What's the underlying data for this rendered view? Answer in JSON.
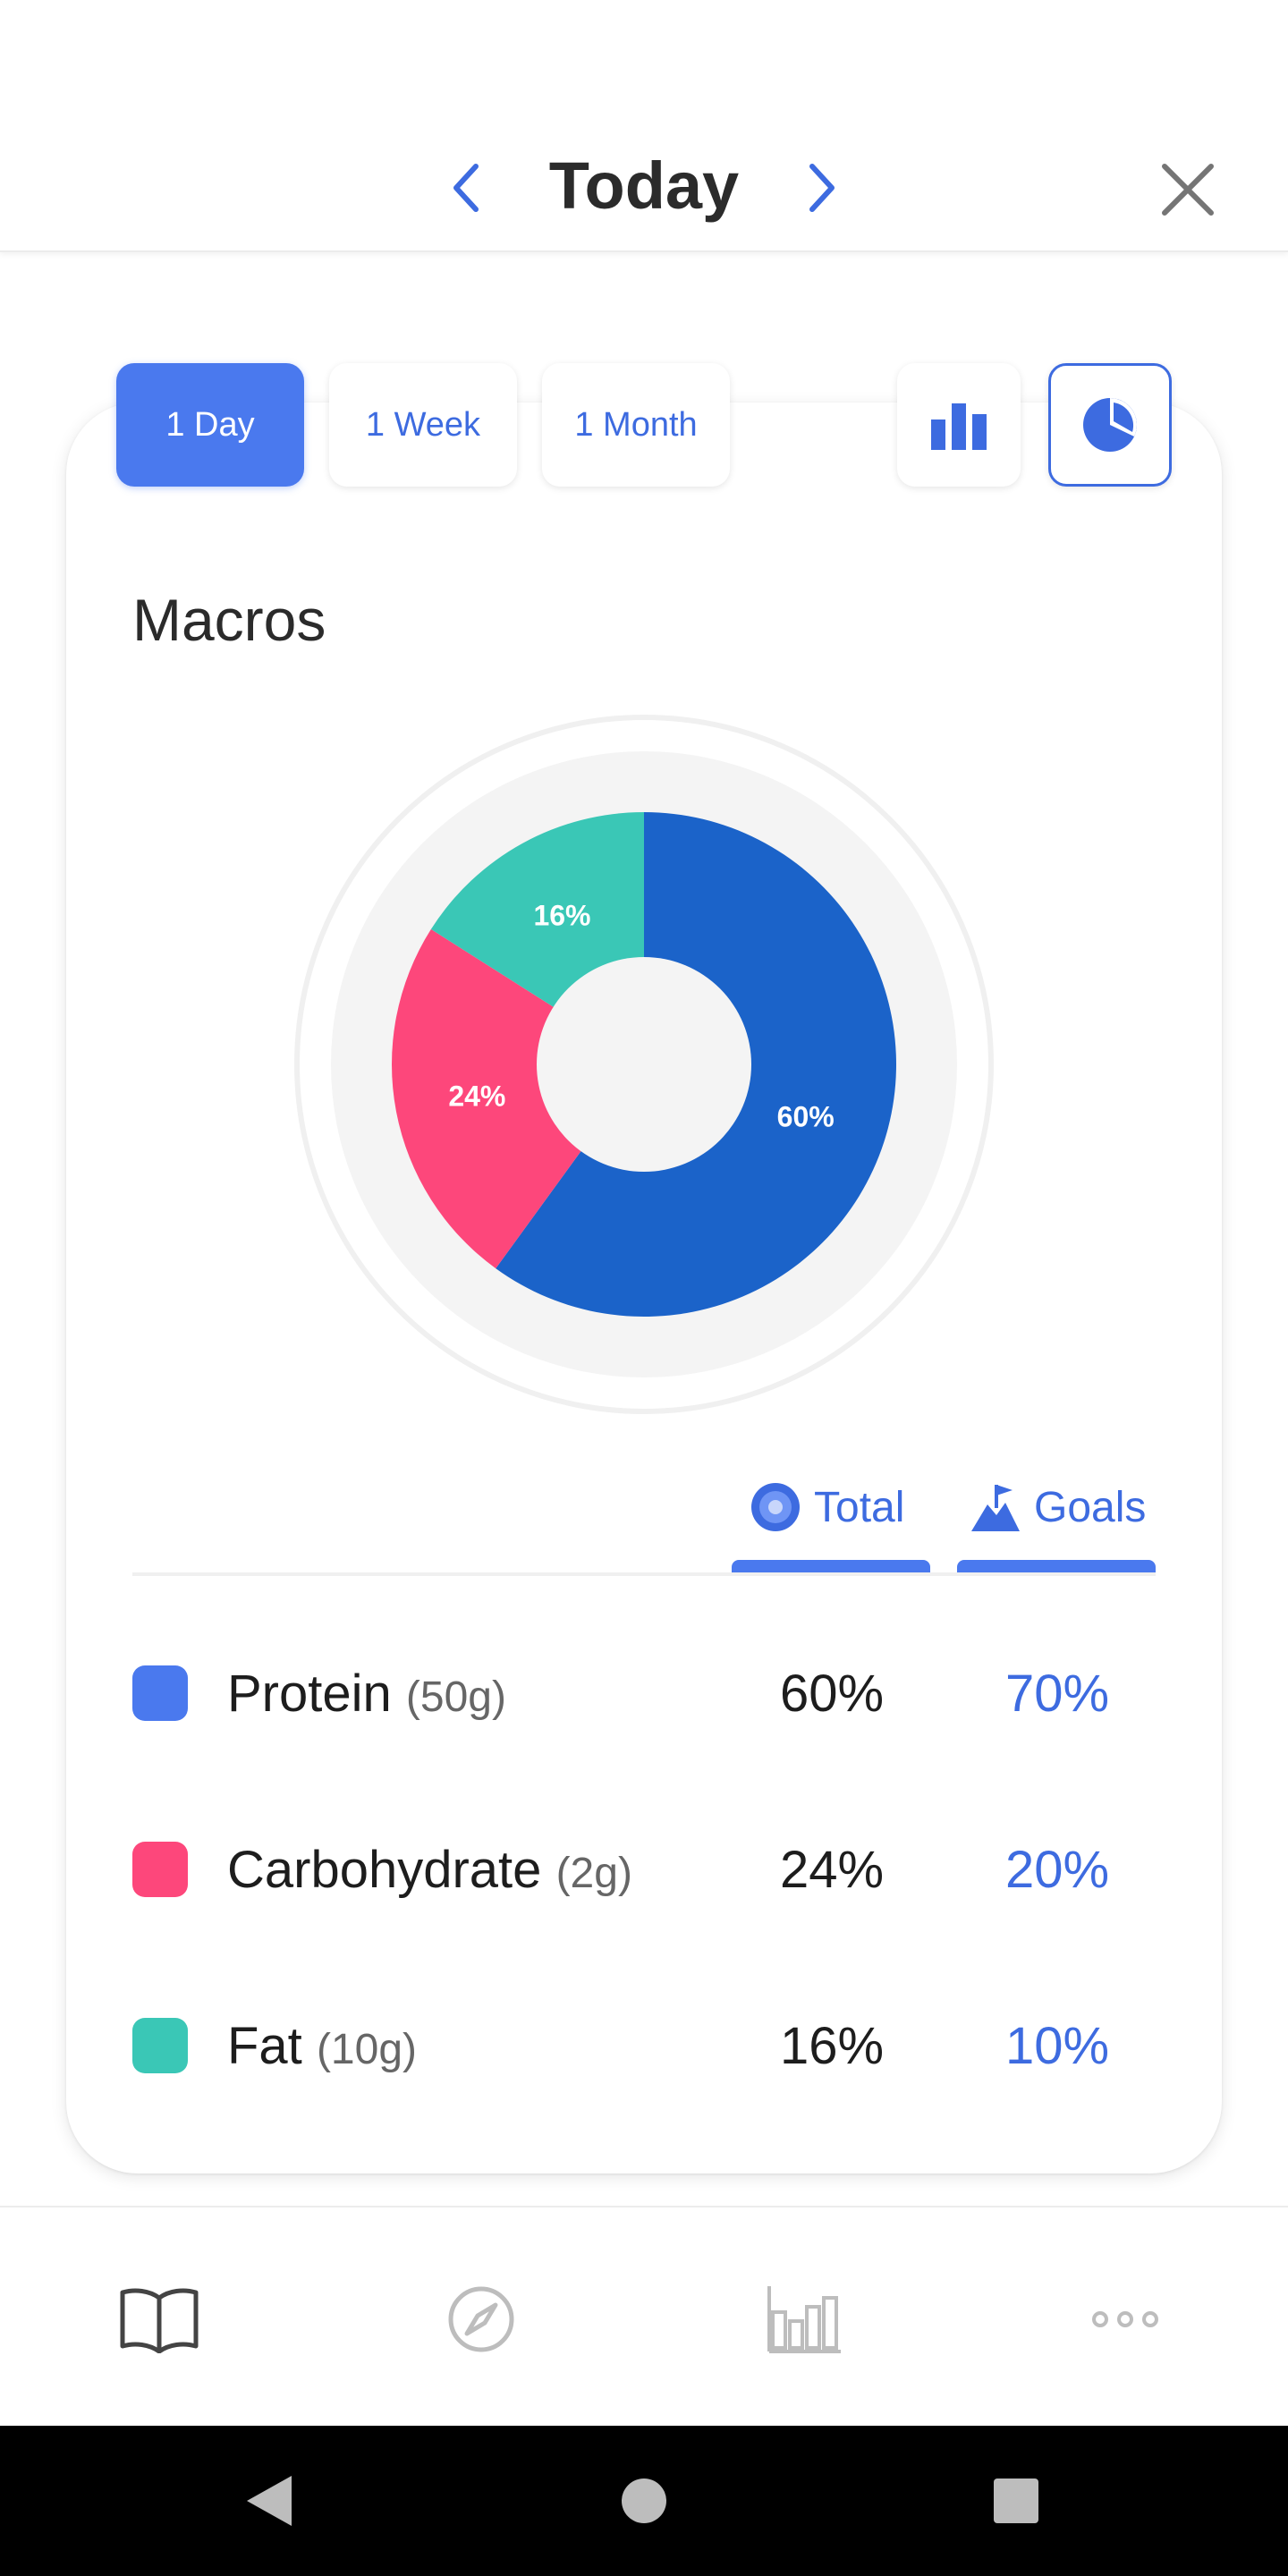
{
  "header": {
    "title": "Today",
    "prev_icon": "chevron-left-icon",
    "next_icon": "chevron-right-icon",
    "close_icon": "close-icon"
  },
  "period_tabs": [
    {
      "label": "1 Day",
      "active": true
    },
    {
      "label": "1 Week",
      "active": false
    },
    {
      "label": "1 Month",
      "active": false
    }
  ],
  "view_toggle": {
    "bar_icon": "bar-chart-icon",
    "pie_icon": "pie-chart-icon",
    "selected": "pie"
  },
  "section_title": "Macros",
  "colors": {
    "accent": "#4a79ee",
    "protein": "#4a79ee",
    "protein_chart": "#1b63c9",
    "carbohydrate": "#fd477b",
    "fat": "#3ac7b6",
    "ring_bg": "#f4f4f4"
  },
  "chart_data": {
    "type": "pie",
    "donut": true,
    "categories": [
      "Protein",
      "Carbohydrate",
      "Fat"
    ],
    "values": [
      60,
      24,
      16
    ],
    "labels": [
      "60%",
      "24%",
      "16%"
    ],
    "colors": [
      "#1b63c9",
      "#fd477b",
      "#3ac7b6"
    ]
  },
  "columns": {
    "total": {
      "label": "Total",
      "icon": "target-icon"
    },
    "goals": {
      "label": "Goals",
      "icon": "mountain-flag-icon"
    }
  },
  "macros": [
    {
      "name": "Protein",
      "amount": "(50g)",
      "total": "60%",
      "goal": "70%"
    },
    {
      "name": "Carbohydrate",
      "amount": "(2g)",
      "total": "24%",
      "goal": "20%"
    },
    {
      "name": "Fat",
      "amount": "(10g)",
      "total": "16%",
      "goal": "10%"
    }
  ],
  "bottom_nav": [
    {
      "name": "diary",
      "icon": "book-icon"
    },
    {
      "name": "discover",
      "icon": "compass-icon"
    },
    {
      "name": "progress",
      "icon": "bar-chart-icon"
    },
    {
      "name": "more",
      "icon": "more-dots-icon"
    }
  ],
  "system_nav": [
    "back-icon",
    "home-icon",
    "recents-icon"
  ]
}
